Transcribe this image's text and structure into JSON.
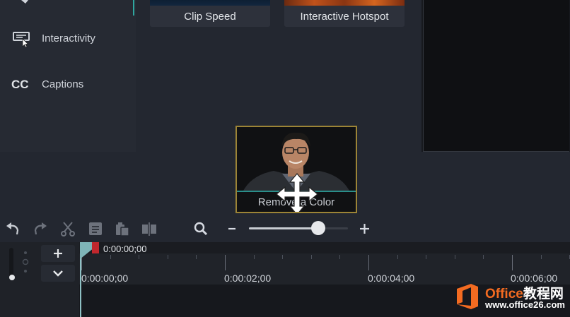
{
  "sidebar": {
    "items": [
      {
        "label": "Interactivity",
        "icon": "interactivity-icon"
      },
      {
        "label": "Captions",
        "icon": "cc-icon",
        "icon_text": "CC"
      }
    ]
  },
  "effects": {
    "tiles": [
      {
        "label": "Clip Speed"
      },
      {
        "label": "Interactive Hotspot"
      }
    ],
    "dragged_tile": {
      "label": "Remove a Color",
      "cursor": "move-icon"
    }
  },
  "toolbar": {
    "buttons": [
      "undo-icon",
      "redo-icon",
      "cut-icon",
      "copy-icon",
      "paste-icon",
      "split-icon"
    ],
    "zoom_level": 0.7
  },
  "timeline": {
    "playhead_time": "0:00:00;00",
    "ruler_labels": [
      "0:00:00;00",
      "0:00:02;00",
      "0:00:04;00",
      "0:00:06;00"
    ]
  },
  "watermark": {
    "brand_prefix": "Office",
    "brand_suffix": "教程网",
    "url": "www.office26.com"
  },
  "colors": {
    "accent": "#2fa7a0",
    "playhead_red": "#c1272d",
    "drag_border": "#9c8436",
    "watermark_orange": "#f36b21"
  }
}
